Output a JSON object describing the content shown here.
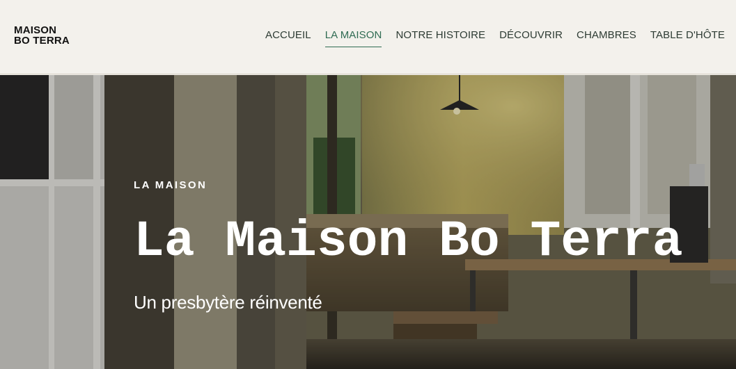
{
  "header": {
    "logo_line1": "MAISON",
    "logo_line2": "BO TERRA",
    "nav": [
      {
        "label": "ACCUEIL",
        "active": false
      },
      {
        "label": "LA MAISON",
        "active": true
      },
      {
        "label": "NOTRE HISTOIRE",
        "active": false
      },
      {
        "label": "DÉCOUVRIR",
        "active": false
      },
      {
        "label": "CHAMBRES",
        "active": false
      },
      {
        "label": "TABLE D'HÔTE",
        "active": false
      }
    ]
  },
  "hero": {
    "eyebrow": "LA MAISON",
    "title": "La Maison Bo Terra",
    "subtitle": "Un presbytère réinventé"
  },
  "colors": {
    "header_bg": "#f3f1ec",
    "nav_text": "#2d3b33",
    "nav_active": "#2f6b52",
    "hero_text": "#ffffff"
  }
}
